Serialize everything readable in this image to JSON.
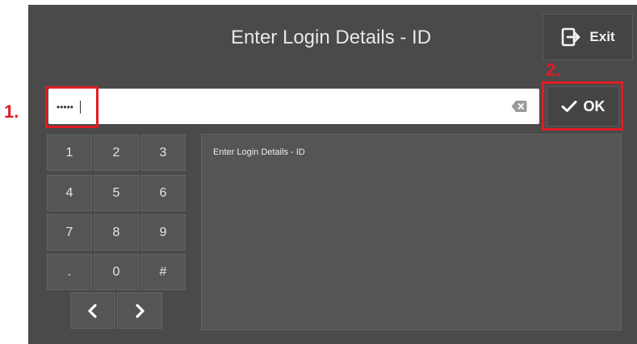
{
  "header": {
    "title": "Enter Login Details - ID",
    "exit_label": "Exit",
    "exit_icon": "exit-icon"
  },
  "input": {
    "value": "•••••",
    "clear_icon": "backspace-clear-icon"
  },
  "ok_button": {
    "label": "OK",
    "icon": "checkmark-icon"
  },
  "annotations": {
    "step1": "1.",
    "step2": "2.",
    "highlight_color": "#e01b24"
  },
  "keypad": {
    "keys": [
      "1",
      "2",
      "3",
      "4",
      "5",
      "6",
      "7",
      "8",
      "9",
      ".",
      "0",
      "#"
    ],
    "prev_icon": "chevron-left-icon",
    "next_icon": "chevron-right-icon"
  },
  "info_panel": {
    "text": "Enter Login Details - ID"
  }
}
